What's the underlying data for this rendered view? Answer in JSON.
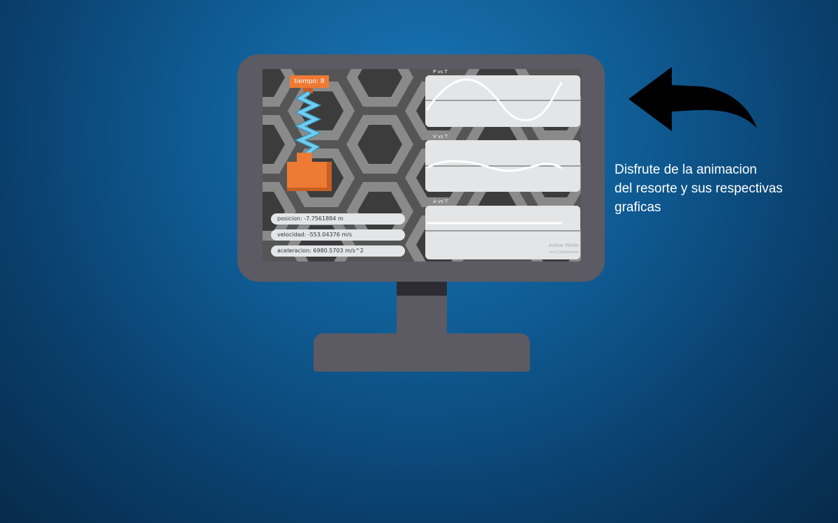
{
  "animation": {
    "timer_label": "tiempo: 8"
  },
  "readouts": {
    "position": "posicion: -7.7561884 m",
    "velocity": "velocidad: -553.04376 m/s",
    "acceleration": "aceleracion: 6980.5703 m/s^2"
  },
  "graphs": [
    {
      "title": "P vs T"
    },
    {
      "title": "V vs T"
    },
    {
      "title": "A vs T"
    }
  ],
  "watermark": {
    "line1": "Activar Windo",
    "line2": "Ve a Configuración"
  },
  "caption": {
    "line1": "Disfrute de la animacion",
    "line2": "del resorte y sus respectivas",
    "line3": "graficas"
  },
  "colors": {
    "background": "#0f5b93",
    "monitor": "#5c5a62",
    "accent_orange": "#ee7a33",
    "spring_blue": "#5fc2e6",
    "panel": "#e3e5e6"
  },
  "icons": {
    "back_arrow": "curved-arrow-left-icon"
  }
}
